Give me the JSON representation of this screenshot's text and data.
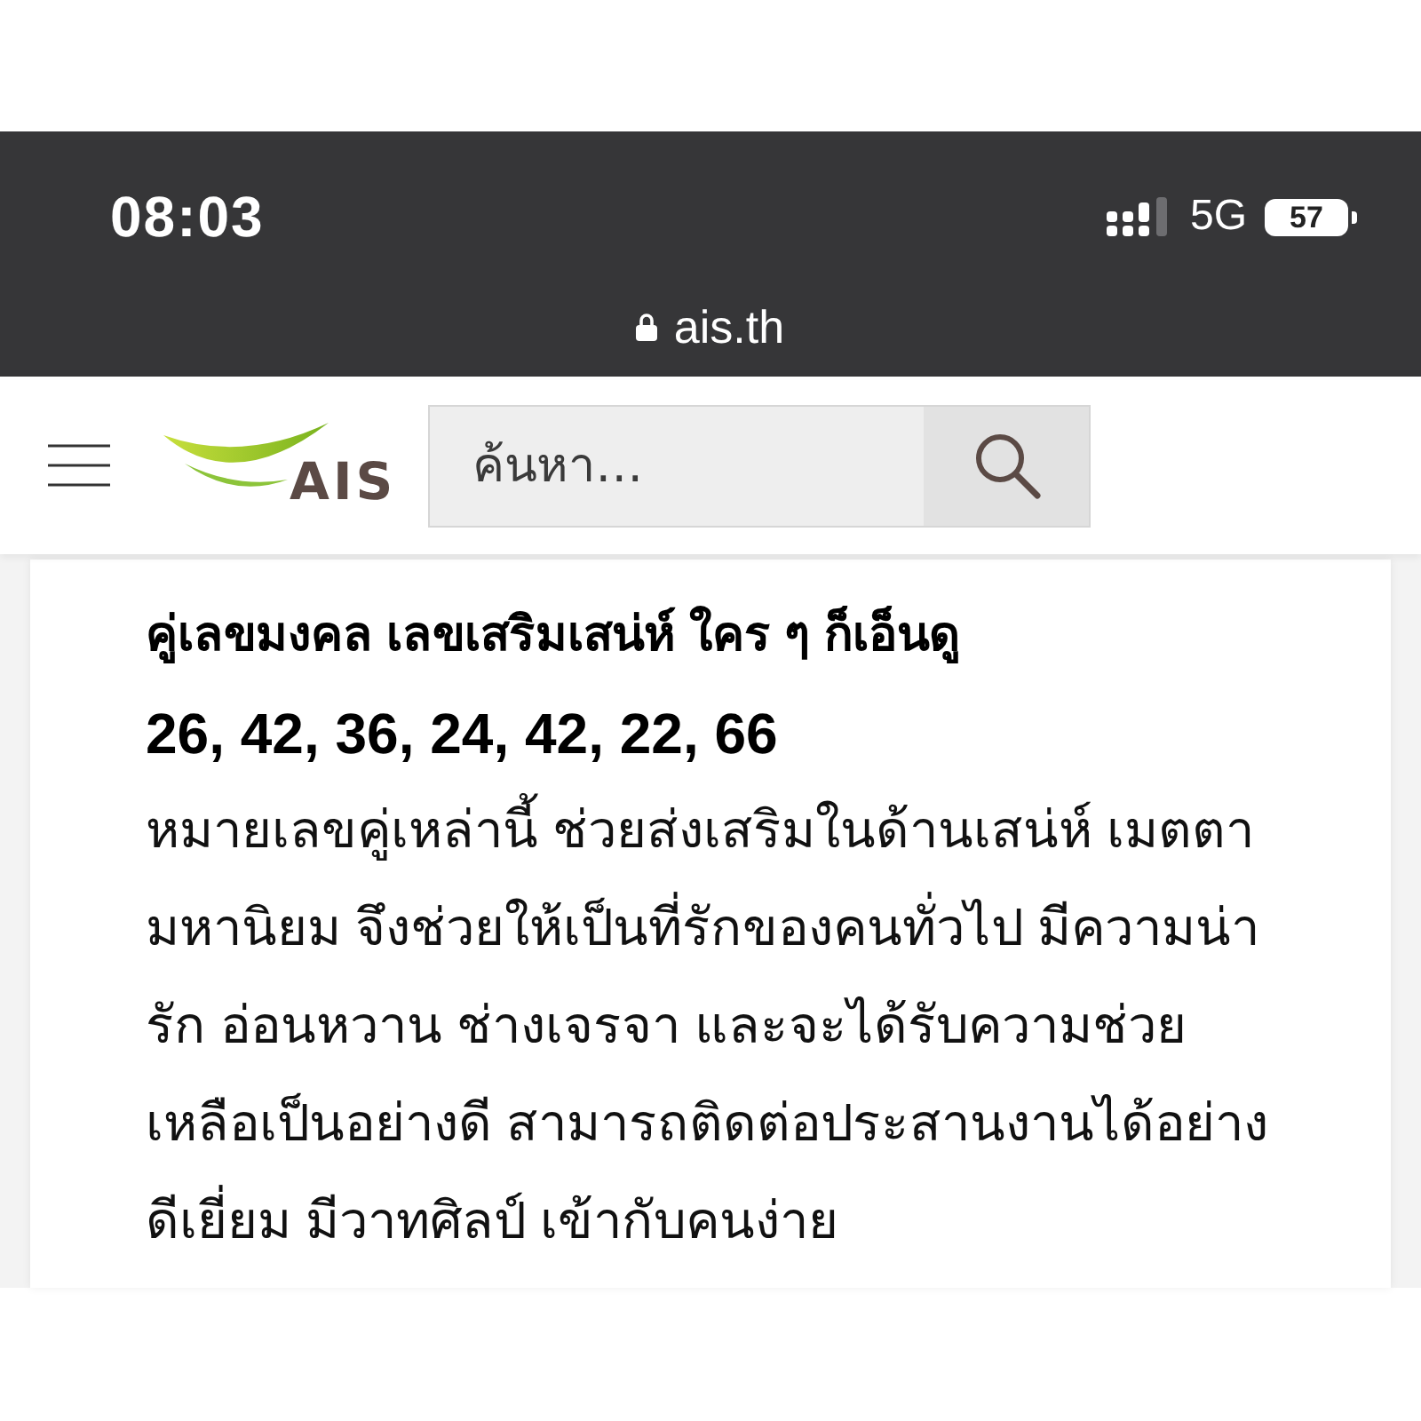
{
  "status_bar": {
    "time": "08:03",
    "network": "5G",
    "battery": "57"
  },
  "address_bar": {
    "url": "ais.th"
  },
  "header": {
    "logo_text": "AIS",
    "search": {
      "placeholder": "ค้นหา…"
    }
  },
  "article": {
    "title": "คู่เลขมงคล เลขเสริมเสน่ห์ ใคร ๆ ก็เอ็นดู",
    "numbers": "26, 42, 36, 24, 42, 22, 66",
    "body": "หมายเลขคู่เหล่านี้ ช่วยส่งเสริมในด้านเสน่ห์ เมตตามหานิยม จึงช่วยให้เป็นที่รักของคนทั่วไป มีความน่ารัก อ่อนหวาน ช่างเจรจา และจะได้รับความช่วยเหลือเป็นอย่างดี สามารถติดต่อประสานงานได้อย่างดีเยี่ยม มีวาทศิลป์ เข้ากับคนง่าย"
  }
}
